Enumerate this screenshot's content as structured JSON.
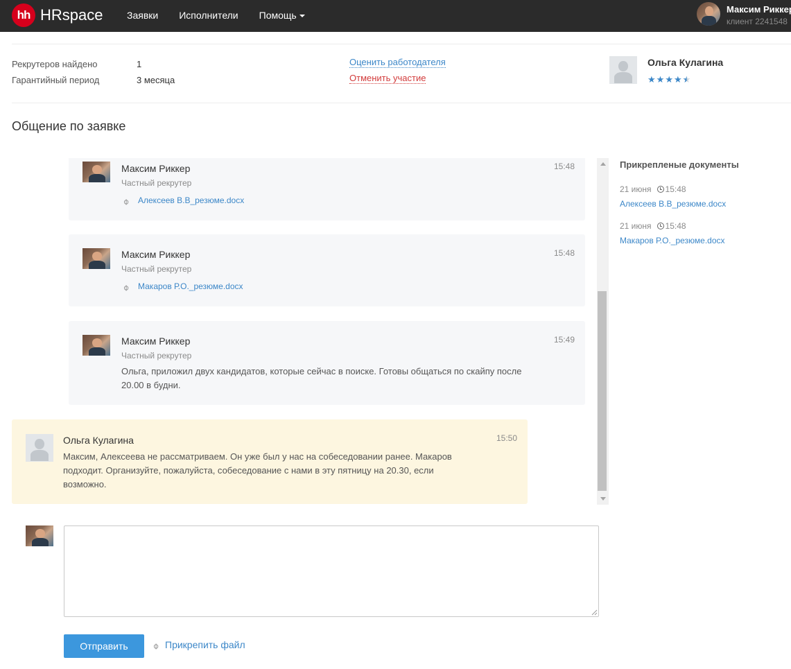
{
  "header": {
    "logo_mark": "hh",
    "logo_text": "HRspace",
    "nav": [
      "Заявки",
      "Исполнители",
      "Помощь"
    ],
    "user_name": "Максим Риккер",
    "user_sub": "клиент 2241548"
  },
  "summary": {
    "recruiters_label": "Рекрутеров найдено",
    "recruiters_value": "1",
    "guarantee_label": "Гарантийный период",
    "guarantee_value": "3 месяца",
    "rate_link": "Оценить работодателя",
    "cancel_link": "Отменить участие",
    "employer_name": "Ольга Кулагина",
    "employer_rating": 4.5,
    "employer_rating_max": 5
  },
  "section_title": "Общение по заявке",
  "messages": [
    {
      "author": "Максим Риккер",
      "role": "Частный рекрутер",
      "time": "15:48",
      "file": "Алексеев В.В_резюме.docx"
    },
    {
      "author": "Максим Риккер",
      "role": "Частный рекрутер",
      "time": "15:48",
      "file": "Макаров Р.О._резюме.docx"
    },
    {
      "author": "Максим Риккер",
      "role": "Частный рекрутер",
      "time": "15:49",
      "text_line1": "Ольга, приложил двух кандидатов, которые сейчас в поиске. Готовы общаться по скайпу после",
      "text_line2": "20.00 в будни."
    },
    {
      "author": "Ольга Кулагина",
      "time": "15:50",
      "text_line1": "Максим, Алексеева не рассматриваем. Он уже был у нас на собеседовании ранее. Макаров",
      "text_line2": "подходит. Организуйте, пожалуйста, собеседование с нами в эту пятницу на 20.30, если",
      "text_line3": "возможно."
    }
  ],
  "docs": {
    "title": "Прикрепленые документы",
    "items": [
      {
        "date": "21 июня",
        "time": "15:48",
        "name": "Алексеев В.В_резюме.docx"
      },
      {
        "date": "21 июня",
        "time": "15:48",
        "name": "Макаров Р.О._резюме.docx"
      }
    ]
  },
  "composer": {
    "value": "",
    "send_label": "Отправить",
    "attach_label": "Прикрепить файл"
  },
  "colors": {
    "topbar": "#2b2b2b",
    "brand": "#d6001c",
    "link": "#3c87c8",
    "danger": "#d23b3b",
    "send_button": "#3c97dd",
    "highlight_message": "#fdf6e0"
  }
}
